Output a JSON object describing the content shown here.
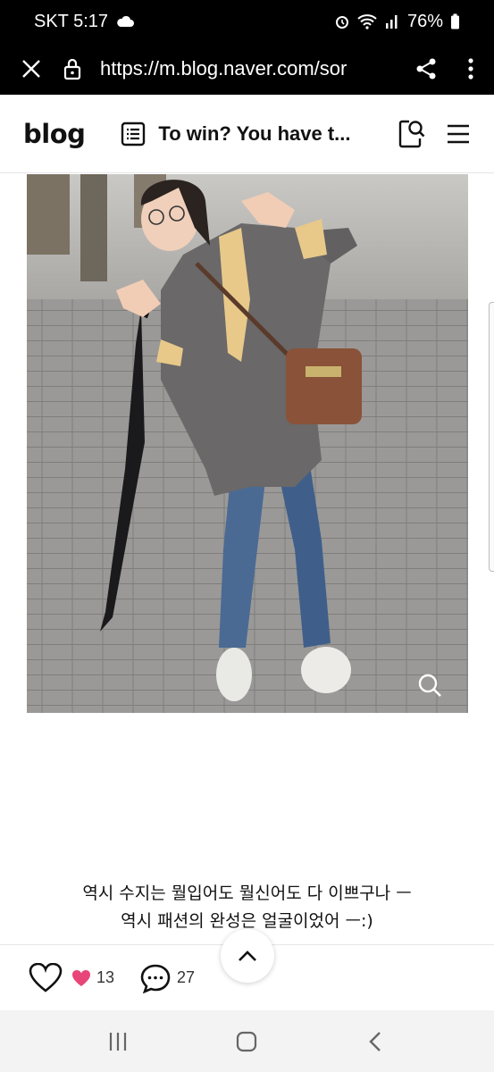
{
  "status_bar": {
    "carrier_time": "SKT 5:17",
    "battery": "76%"
  },
  "browser": {
    "url": "https://m.blog.naver.com/sor"
  },
  "blog_header": {
    "logo": "blog",
    "post_title": "To win? You have t..."
  },
  "post": {
    "image_alt": "Woman in glasses, grey tweed blazer, yellow shirt, jeans and white sneakers waving while holding a black umbrella",
    "lines": [
      "역시 수지는 뭘입어도 뭘신어도 다 이쁘구나 ㅡ",
      "역시 패션의 완성은 얼굴이었어 ㅡ:)"
    ]
  },
  "reactions": {
    "likes": "13",
    "comments": "27"
  },
  "colors": {
    "like_heart": "#e8457a",
    "header_text": "#111111"
  }
}
